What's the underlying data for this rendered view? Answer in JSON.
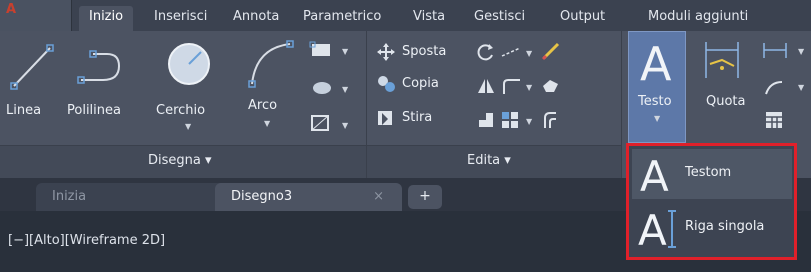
{
  "ribbon_tabs": {
    "app_menu": "A",
    "items": [
      "Inizio",
      "Inserisci",
      "Annota",
      "Parametrico",
      "Vista",
      "Gestisci",
      "Output",
      "Moduli aggiunti"
    ]
  },
  "panels": {
    "disegna": {
      "title": "Disegna ▾",
      "tools": {
        "linea": "Linea",
        "polilinea": "Polilinea",
        "cerchio": "Cerchio",
        "arco": "Arco"
      }
    },
    "edita": {
      "title": "Edita ▾",
      "tools": {
        "sposta": "Sposta",
        "copia": "Copia",
        "stira": "Stira"
      }
    },
    "annotazione": {
      "tools": {
        "testo": "Testo",
        "quota": "Quota"
      }
    }
  },
  "text_dropdown": {
    "items": [
      {
        "label": "Testom"
      },
      {
        "label": "Riga singola"
      }
    ]
  },
  "document_tabs": {
    "items": [
      {
        "label": "Inizia"
      },
      {
        "label": "Disegno3",
        "close": "×"
      }
    ],
    "add": "+"
  },
  "viewport": {
    "label": "[−][Alto][Wireframe 2D]"
  },
  "colors": {
    "ribbon": "#4c5362",
    "highlight": "#5d78a8",
    "dropdown_border": "#e0202a",
    "background": "#29303b"
  }
}
